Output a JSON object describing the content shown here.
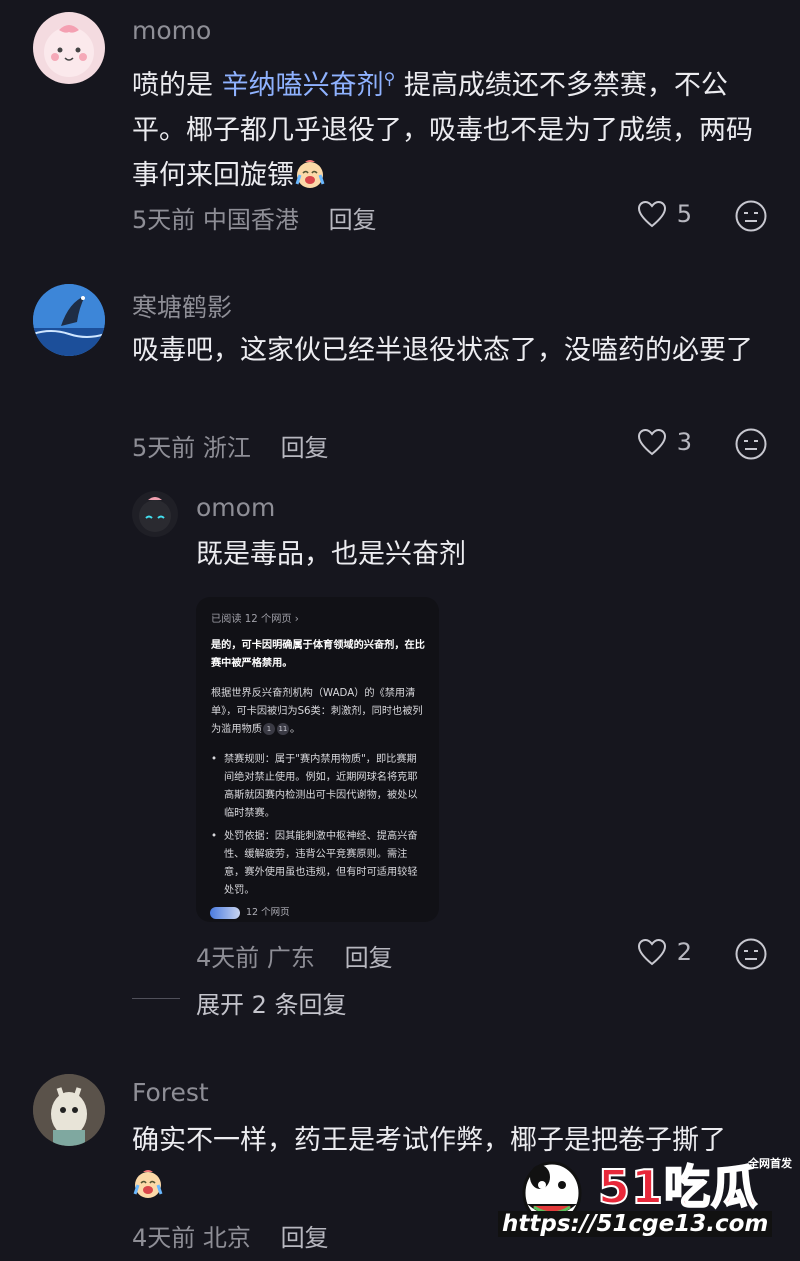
{
  "comments": [
    {
      "username": "momo",
      "text_before": "喷的是 ",
      "link": "辛纳嗑兴奋剂",
      "text_after": " 提高成绩还不多禁赛，不公平。椰子都几乎退役了，吸毒也不是为了成绩，两码事何来回旋镖",
      "time": "5天前",
      "location": "中国香港",
      "reply_label": "回复",
      "likes": "5"
    },
    {
      "username": "寒塘鹤影",
      "text": "吸毒吧，这家伙已经半退役状态了，没嗑药的必要了",
      "time": "5天前",
      "location": "浙江",
      "reply_label": "回复",
      "likes": "3"
    },
    {
      "username": "omom",
      "text": "既是毒品，也是兴奋剂",
      "time": "4天前",
      "location": "广东",
      "reply_label": "回复",
      "likes": "2"
    },
    {
      "username": "Forest",
      "text": "确实不一样，药王是考试作弊，椰子是把卷子撕了",
      "time": "4天前",
      "location": "北京",
      "reply_label": "回复"
    }
  ],
  "screenshot": {
    "header": "已阅读 12 个网页 ›",
    "p1": "是的，可卡因明确属于体育领域的兴奋剂，在比赛中被严格禁用。",
    "p2": "根据世界反兴奋剂机构（WADA）的《禁用清单》，可卡因被归为S6类：刺激剂，同时也被列为滥用物质",
    "b1": "禁赛规则：属于\"赛内禁用物质\"，即比赛期间绝对禁止使用。例如，近期网球名将克耶高斯就因赛内检测出可卡因代谢物，被处以临时禁赛。",
    "b2": "处罚依据：因其能刺激中枢神经、提高兴奋性、缓解疲劳，违背公平竞赛原则。需注意，赛外使用虽也违规，但有时可适用较轻处罚。",
    "sources": "12 个网页"
  },
  "expand_replies": "展开 2 条回复",
  "watermark": {
    "brand": "51吃瓜",
    "tag": "全网首发",
    "url": "https://51cge13.com"
  },
  "colors": {
    "background": "#16161e",
    "link": "#8fb2ff",
    "muted": "#8e8e96"
  }
}
